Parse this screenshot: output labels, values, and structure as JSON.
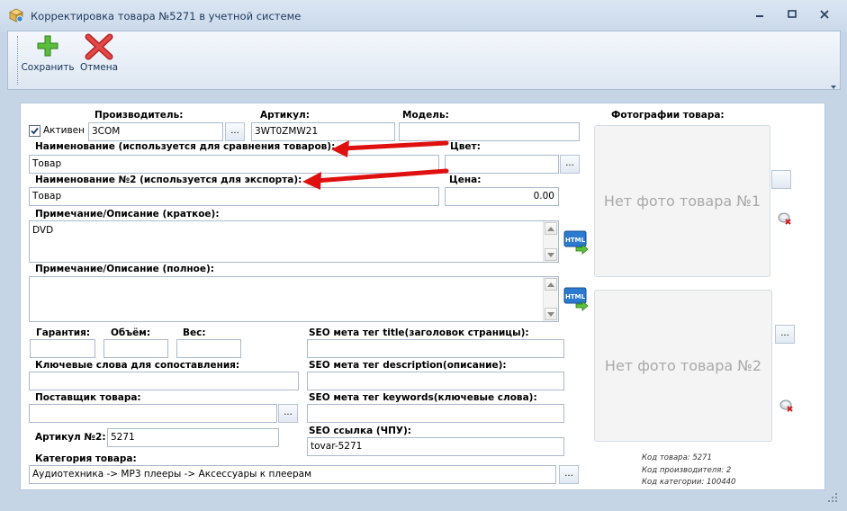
{
  "window": {
    "title": "Корректировка товара №5271 в учетной системе",
    "controls": [
      "minimize",
      "maximize",
      "close"
    ]
  },
  "toolbar": {
    "save_label": "Сохранить",
    "cancel_label": "Отмена"
  },
  "form": {
    "active": {
      "label": "Активен",
      "checked": true
    },
    "manufacturer": {
      "label": "Производитель:",
      "value": "3COM"
    },
    "article": {
      "label": "Артикул:",
      "value": "3WT0ZMW21"
    },
    "model": {
      "label": "Модель:",
      "value": ""
    },
    "name": {
      "label": "Наименование (используется для сравнения товаров):",
      "value": "Товар"
    },
    "color": {
      "label": "Цвет:",
      "value": ""
    },
    "name2": {
      "label": "Наименование №2 (используется для экспорта):",
      "value": "Товар"
    },
    "price": {
      "label": "Цена:",
      "value": "0.00"
    },
    "note_short": {
      "label": "Примечание/Описание (краткое):",
      "value": "DVD"
    },
    "note_full": {
      "label": "Примечание/Описание (полное):",
      "value": ""
    },
    "warranty": {
      "label": "Гарантия:",
      "value": ""
    },
    "volume": {
      "label": "Объём:",
      "value": ""
    },
    "weight": {
      "label": "Вес:",
      "value": ""
    },
    "keywords_match": {
      "label": "Ключевые слова для сопоставления:",
      "value": ""
    },
    "supplier": {
      "label": "Поставщик товара:",
      "value": ""
    },
    "article2": {
      "label": "Артикул №2:",
      "value": "5271"
    },
    "category": {
      "label": "Категория товара:",
      "value": "Аудиотехника -> MP3 плееры -> Аксессуары к плеерам"
    },
    "seo_title": {
      "label": "SEO мета тег title(заголовок страницы):",
      "value": ""
    },
    "seo_description": {
      "label": "SEO мета тег description(описание):",
      "value": ""
    },
    "seo_keywords": {
      "label": "SEO мета тег keywords(ключевые слова):",
      "value": ""
    },
    "seo_url": {
      "label": "SEO ссылка (ЧПУ):",
      "value": "tovar-5271"
    },
    "browse_label": "...",
    "html_button_label": "HTML"
  },
  "photos": {
    "label": "Фотографии товара:",
    "photo1_placeholder": "Нет фото товара №1",
    "photo2_placeholder": "Нет фото товара №2"
  },
  "info": {
    "product_code": "Код товара: 5271",
    "manufacturer_code": "Код производителя: 2",
    "category_code": "Код категории: 100440"
  },
  "colors": {
    "titlebar": "#dbe6f3",
    "background": "#c6d5e6",
    "annotation_arrow": "#e01010"
  }
}
